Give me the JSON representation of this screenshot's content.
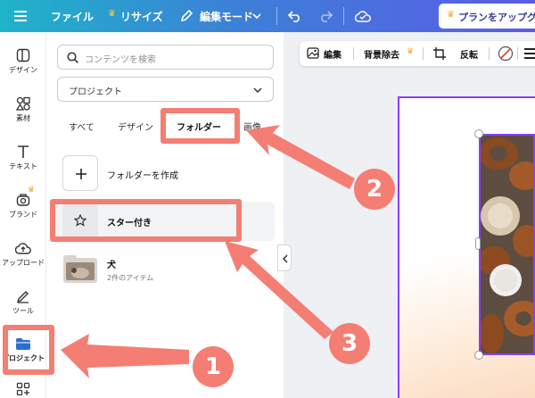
{
  "topbar": {
    "file_label": "ファイル",
    "resize_label": "リサイズ",
    "edit_mode_label": "編集モード",
    "upgrade_label": "プランをアップグ"
  },
  "rail": {
    "items": [
      {
        "label": "デザイン",
        "icon": "design-icon"
      },
      {
        "label": "素材",
        "icon": "elements-icon"
      },
      {
        "label": "テキスト",
        "icon": "text-icon"
      },
      {
        "label": "ブランド",
        "icon": "brand-icon"
      },
      {
        "label": "アップロード",
        "icon": "upload-icon"
      },
      {
        "label": "ツール",
        "icon": "tools-icon"
      },
      {
        "label": "プロジェクト",
        "icon": "folder-icon"
      }
    ]
  },
  "panel": {
    "search_placeholder": "コンテンツを検索",
    "select_value": "プロジェクト",
    "tabs": [
      "すべて",
      "デザイン",
      "フォルダー",
      "画像"
    ],
    "active_tab": "フォルダー",
    "create_folder": "フォルダーを作成",
    "starred": "スター付き",
    "folder_name": "犬",
    "folder_count": "2件のアイテム"
  },
  "canvas_toolbar": {
    "edit_label": "編集",
    "remove_bg_label": "背景除去",
    "flip_label": "反転"
  },
  "annotations": {
    "numbers": [
      "1",
      "2",
      "3"
    ],
    "color": "#f47e73"
  },
  "colors": {
    "topbar_start": "#1fb4c9",
    "topbar_end": "#5b5ce6",
    "page_border": "#8b3dff",
    "annotation": "#f47e73"
  }
}
